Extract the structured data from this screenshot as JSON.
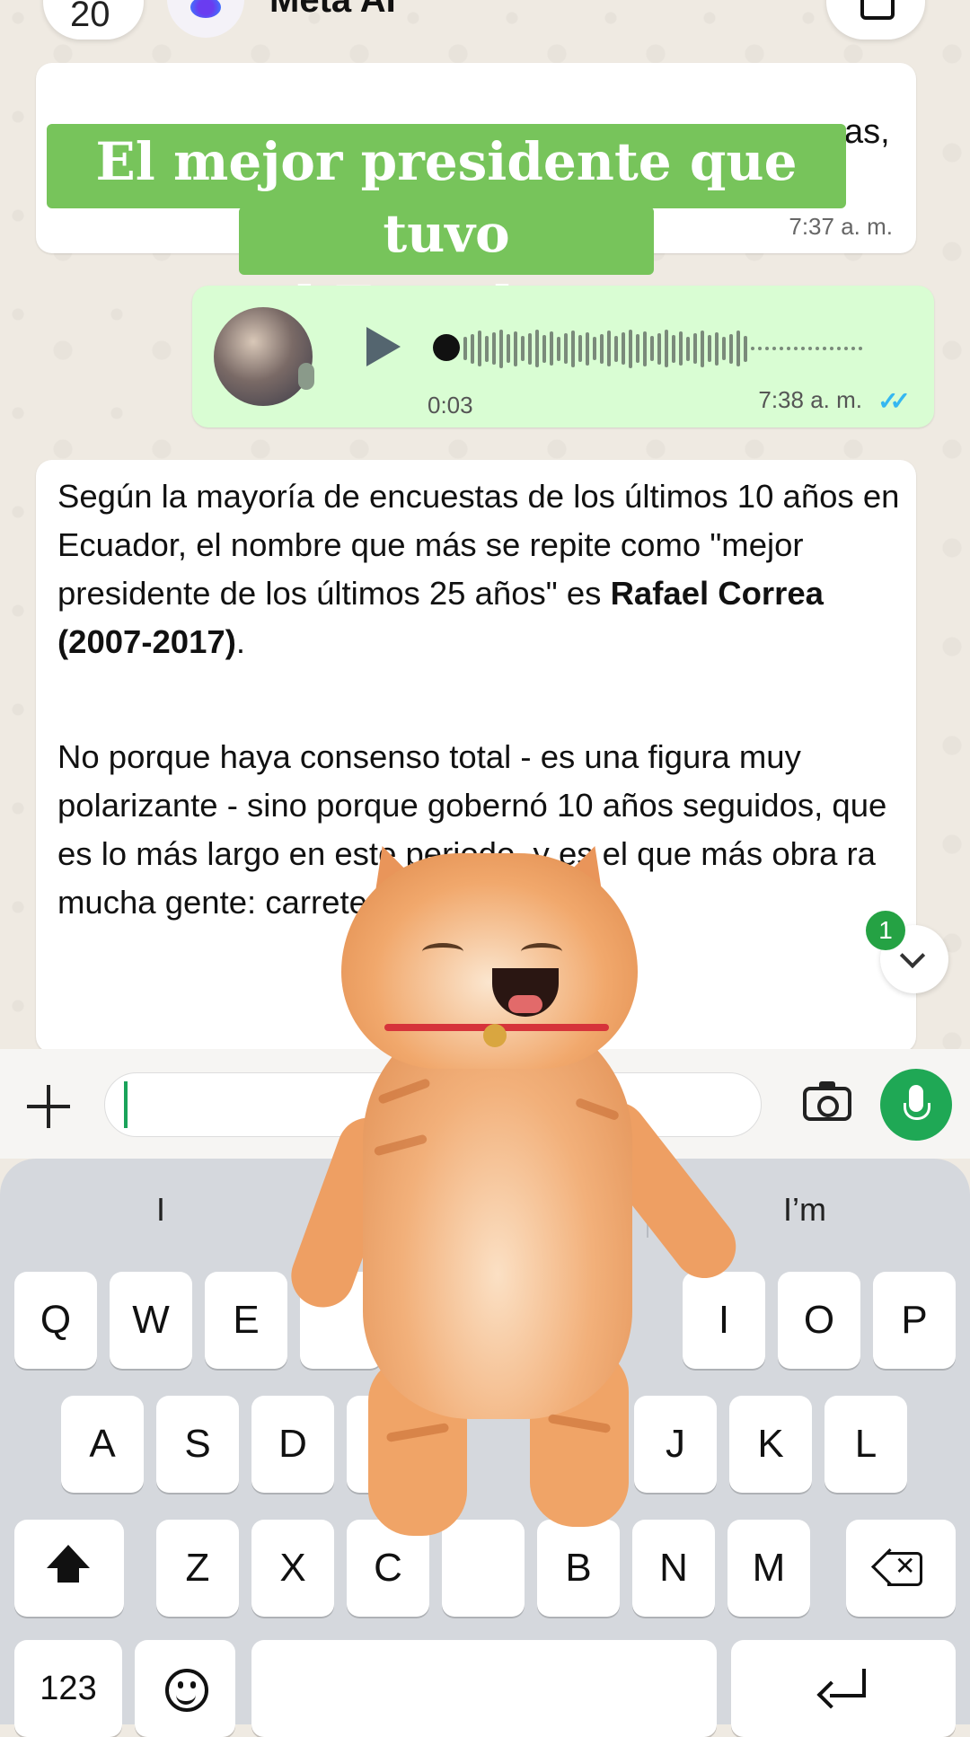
{
  "header": {
    "back_label": "20",
    "title": "Meta AI"
  },
  "messages": {
    "incoming_1": {
      "partial_text": "as,",
      "time": "7:37 a. m."
    },
    "voice": {
      "duration": "0:03",
      "time": "7:38 a. m.",
      "ticks": "✓✓"
    },
    "answer": {
      "p1_text": "Según la mayoría de encuestas de los últimos 10 años en Ecuador, el nombre que más se repite como \"mejor presidente de los últimos 25 años\" es ",
      "p1_bold": "Rafael Correa (2007-2017)",
      "p1_end": ".",
      "p2_text": "No porque haya consenso total - es una figura muy polarizante - sino porque gobernó 10 años seguidos, que es lo más largo en este periodo, y es el que más obra ra mucha gente: carreteras, hospit"
    },
    "unread_badge": "1"
  },
  "caption": {
    "line1": "El mejor presidente que tuvo",
    "line2": "el Ecuador"
  },
  "keyboard": {
    "suggestions": [
      "I",
      "I’m"
    ],
    "row1": [
      "Q",
      "W",
      "E",
      "I",
      "O",
      "P"
    ],
    "row2": [
      "A",
      "S",
      "D",
      "J",
      "K",
      "L"
    ],
    "row3": [
      "Z",
      "X",
      "C",
      "B",
      "N",
      "M"
    ],
    "numbers_key": "123"
  },
  "colors": {
    "caption_bg": "#77c45b",
    "outgoing_bubble": "#d9fdd3",
    "mic_button": "#1fa855",
    "read_ticks": "#34b7f1"
  }
}
